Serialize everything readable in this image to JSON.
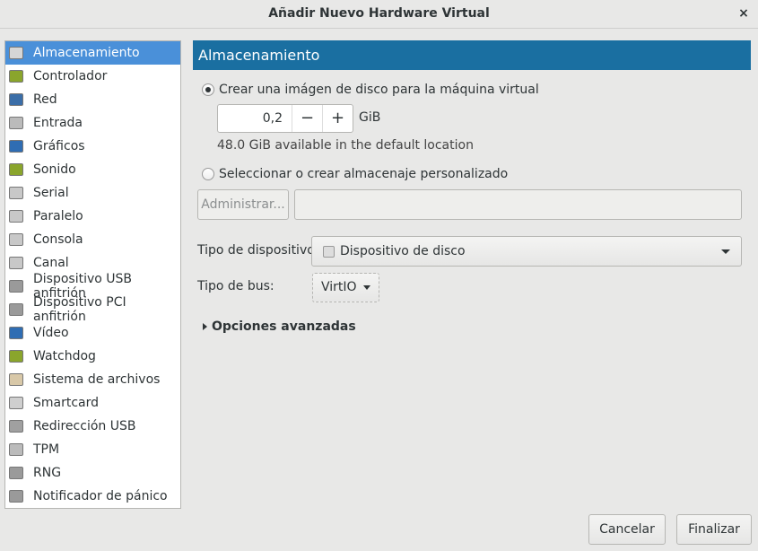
{
  "window": {
    "title": "Añadir Nuevo Hardware Virtual",
    "close": "×"
  },
  "sidebar": {
    "items": [
      {
        "label": "Almacenamiento",
        "icon": "disk-icon",
        "color": "#d6d6d6",
        "selected": true
      },
      {
        "label": "Controlador",
        "icon": "pci-card-icon",
        "color": "#8aa52c"
      },
      {
        "label": "Red",
        "icon": "network-icon",
        "color": "#3b6ea8"
      },
      {
        "label": "Entrada",
        "icon": "mouse-icon",
        "color": "#bbbbbb"
      },
      {
        "label": "Gráficos",
        "icon": "monitor-icon",
        "color": "#2f6db3"
      },
      {
        "label": "Sonido",
        "icon": "sound-card-icon",
        "color": "#8aa52c"
      },
      {
        "label": "Serial",
        "icon": "serial-port-icon",
        "color": "#c8c8c8"
      },
      {
        "label": "Paralelo",
        "icon": "parallel-port-icon",
        "color": "#c8c8c8"
      },
      {
        "label": "Consola",
        "icon": "console-port-icon",
        "color": "#c8c8c8"
      },
      {
        "label": "Canal",
        "icon": "channel-port-icon",
        "color": "#c8c8c8"
      },
      {
        "label": "Dispositivo USB anfitrión",
        "icon": "usb-device-icon",
        "color": "#9a9a9a"
      },
      {
        "label": "Dispositivo PCI anfitrión",
        "icon": "pci-device-icon",
        "color": "#9a9a9a"
      },
      {
        "label": "Vídeo",
        "icon": "video-icon",
        "color": "#2f6db3"
      },
      {
        "label": "Watchdog",
        "icon": "watchdog-icon",
        "color": "#8aa52c"
      },
      {
        "label": "Sistema de archivos",
        "icon": "folder-icon",
        "color": "#d8c8a8"
      },
      {
        "label": "Smartcard",
        "icon": "smartcard-icon",
        "color": "#cfcfcf"
      },
      {
        "label": "Redirección USB",
        "icon": "usb-redirect-icon",
        "color": "#a0a0a0"
      },
      {
        "label": "TPM",
        "icon": "chip-icon",
        "color": "#bbbbbb"
      },
      {
        "label": "RNG",
        "icon": "rng-icon",
        "color": "#9a9a9a"
      },
      {
        "label": "Notificador de pánico",
        "icon": "panic-icon",
        "color": "#9a9a9a"
      }
    ]
  },
  "main": {
    "header": "Almacenamiento",
    "create_label": "Crear una imágen de disco para la máquina virtual",
    "size_value": "0,2",
    "minus": "−",
    "plus": "+",
    "unit": "GiB",
    "available": "48.0 GiB available in the default location",
    "custom_label": "Seleccionar o crear almacenaje personalizado",
    "manage_label": "Administrar...",
    "path_value": "",
    "device_type_label": "Tipo de dispositivo:",
    "device_type_value": "Dispositivo de disco",
    "bus_type_label": "Tipo de bus:",
    "bus_type_value": "VirtIO",
    "advanced_label": "Opciones avanzadas"
  },
  "footer": {
    "cancel": "Cancelar",
    "finish": "Finalizar"
  }
}
